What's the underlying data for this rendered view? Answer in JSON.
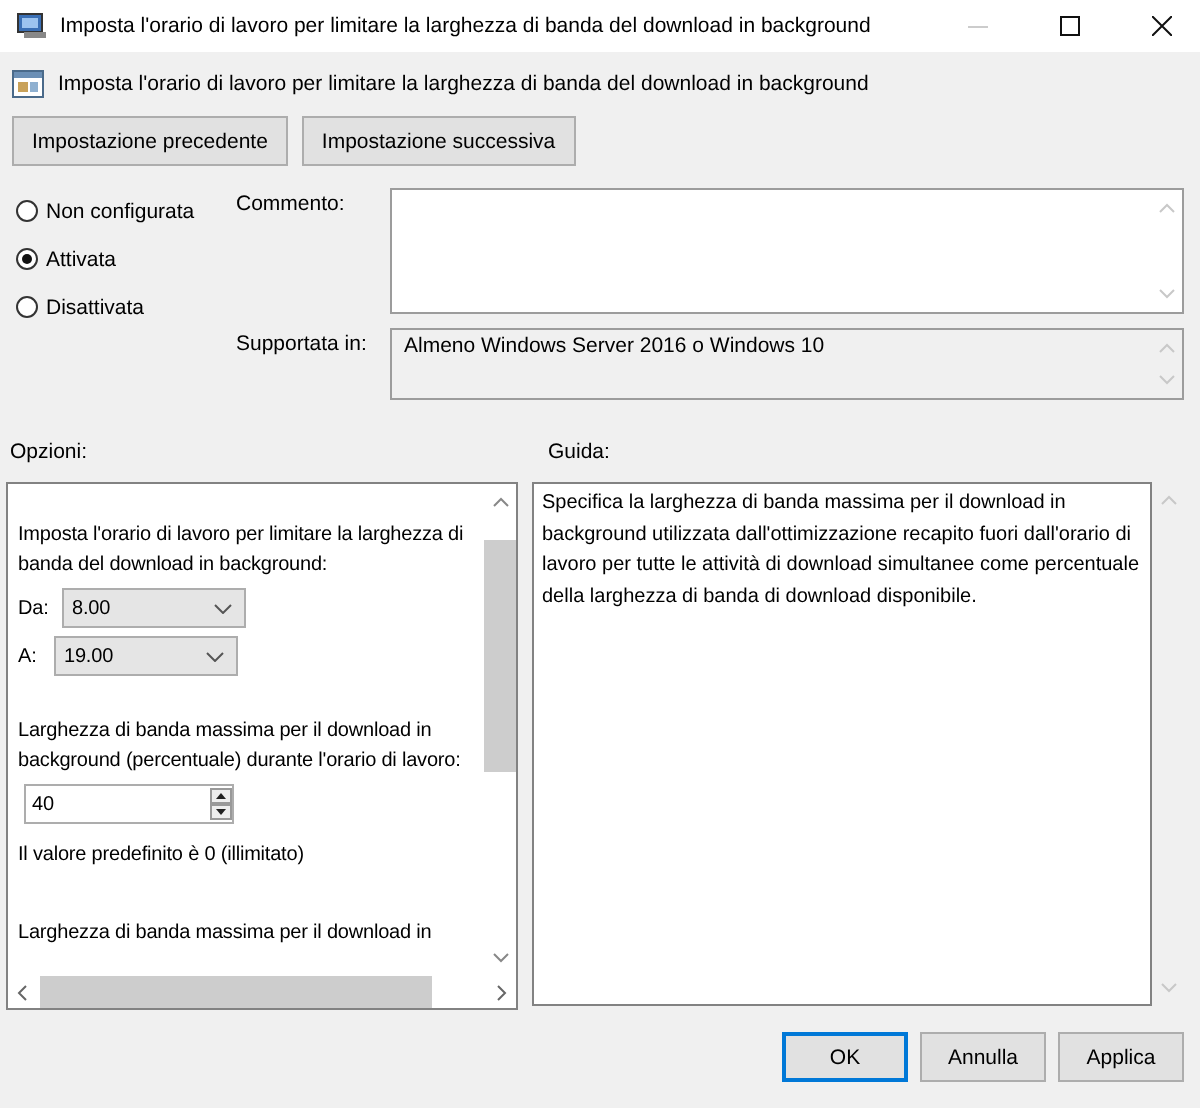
{
  "window": {
    "title": "Imposta l'orario di lavoro per limitare la larghezza di banda del download in background"
  },
  "header": {
    "title": "Imposta l'orario di lavoro per limitare la larghezza di banda del download in background"
  },
  "nav_buttons": [
    "Impostazione precedente",
    "Impostazione successiva"
  ],
  "states": [
    {
      "label": "Non configurata",
      "selected": false
    },
    {
      "label": "Attivata",
      "selected": true
    },
    {
      "label": "Disattivata",
      "selected": false
    }
  ],
  "comment": {
    "label": "Commento:"
  },
  "supported": {
    "label": "Supportata in:",
    "value": "Almeno Windows Server 2016 o Windows 10"
  },
  "options": {
    "label": "Opzioni:",
    "items": [
      {
        "kind": "text",
        "text": "Imposta l'orario di lavoro per limitare la larghezza di banda del download in background:"
      },
      {
        "kind": "dropdown",
        "label": "Da:",
        "value": "8.00"
      },
      {
        "kind": "dropdown",
        "label": "A:",
        "value": "19.00"
      },
      {
        "kind": "text",
        "text": "Larghezza di banda massima per il download in background (percentuale) durante l'orario di lavoro:"
      },
      {
        "kind": "spinner",
        "value": "40"
      },
      {
        "kind": "text",
        "text": "Il valore predefinito è 0 (illimitato)"
      },
      {
        "kind": "text",
        "text": "Larghezza di banda massima per il download in"
      }
    ]
  },
  "help": {
    "label": "Guida:",
    "text": "Specifica la larghezza di banda massima per il download in background utilizzata dall'ottimizzazione recapito fuori dall'orario di lavoro per tutte le attività di download simultanee come percentuale della larghezza di banda di download disponibile."
  },
  "buttons": [
    {
      "label": "OK",
      "default": true
    },
    {
      "label": "Annulla",
      "default": false
    },
    {
      "label": "Applica",
      "default": false
    }
  ]
}
